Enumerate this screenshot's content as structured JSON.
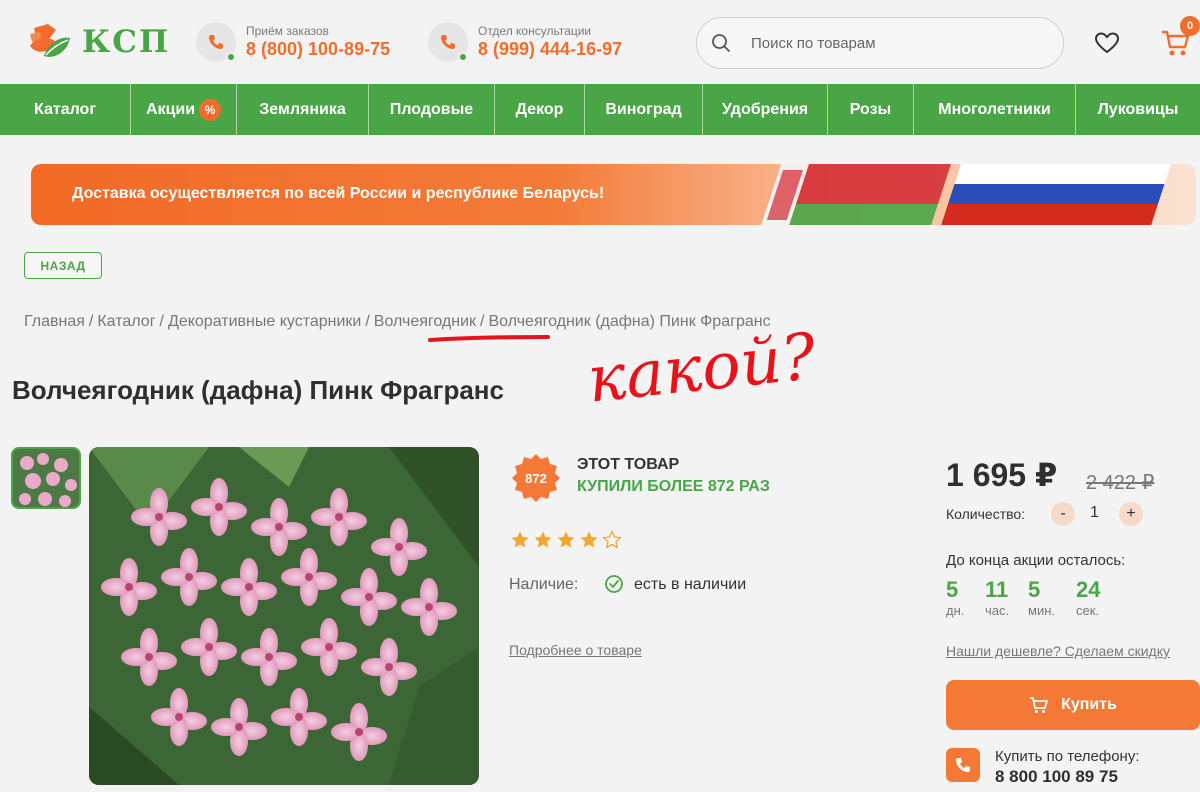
{
  "header": {
    "logo_text": "КСП",
    "phones": [
      {
        "caption": "Приём заказов",
        "number": "8 (800) 100-89-75"
      },
      {
        "caption": "Отдел консультации",
        "number": "8 (999) 444-16-97"
      }
    ],
    "search_placeholder": "Поиск по товарам",
    "cart_count": "0"
  },
  "nav": {
    "items": [
      {
        "label": "Каталог"
      },
      {
        "label": "Акции",
        "badge": "%"
      },
      {
        "label": "Земляника"
      },
      {
        "label": "Плодовые"
      },
      {
        "label": "Декор"
      },
      {
        "label": "Виноград"
      },
      {
        "label": "Удобрения"
      },
      {
        "label": "Розы"
      },
      {
        "label": "Многолетники"
      },
      {
        "label": "Луковицы"
      }
    ]
  },
  "banner": {
    "text": "Доставка осуществляется по всей России и республике Беларусь!"
  },
  "back_label": "НАЗАД",
  "breadcrumb": [
    "Главная",
    "Каталог",
    "Декоративные кустарники",
    "Волчеягодник",
    "Волчеягодник (дафна) Пинк Фрагранс"
  ],
  "annotation_text": "какой?",
  "product": {
    "title": "Волчеягодник (дафна) Пинк Фрагранс",
    "bought_count": "872",
    "bought_line1": "ЭТОТ ТОВАР",
    "bought_line2": "КУПИЛИ БОЛЕЕ 872 РАЗ",
    "rating": 4,
    "rating_max": 5,
    "stock_label": "Наличие:",
    "stock_value": "есть в наличии",
    "more_link": "Подробнее о товаре"
  },
  "purchase": {
    "price": "1 695 ₽",
    "old_price": "2 422 ₽",
    "qty_label": "Количество:",
    "qty_minus": "-",
    "qty_value": "1",
    "qty_plus": "+",
    "timer_label": "До конца акции осталось:",
    "timer": [
      {
        "value": "5",
        "unit": "дн."
      },
      {
        "value": "11",
        "unit": "час."
      },
      {
        "value": "5",
        "unit": "мин."
      },
      {
        "value": "24",
        "unit": "сек."
      }
    ],
    "cheaper_link": "Нашли дешевле? Сделаем скидку",
    "buy_label": "Купить",
    "phone_buy_label": "Купить по телефону:",
    "phone_buy_number": "8 800 100 89 75"
  },
  "colors": {
    "brand_green": "#4aa546",
    "accent_orange": "#f26d2d",
    "annotation_red": "#e8131a"
  }
}
